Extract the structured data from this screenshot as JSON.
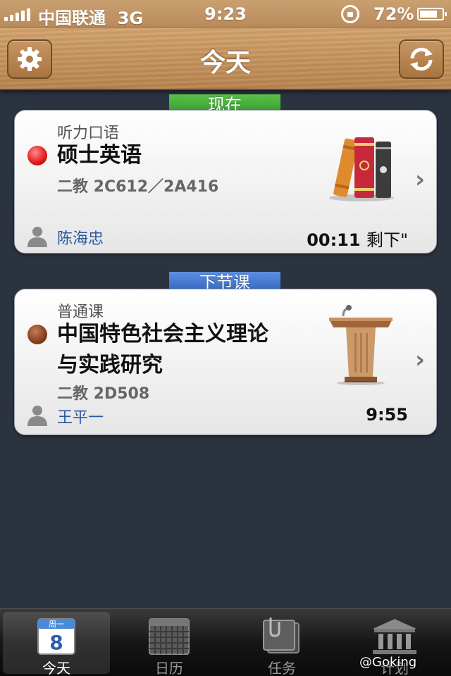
{
  "status_bar": {
    "carrier": "中国联通",
    "network": "3G",
    "time": "9:23",
    "battery": "72%"
  },
  "nav": {
    "title": "今天",
    "left_icon": "gear-icon",
    "right_icon": "refresh-icon"
  },
  "current": {
    "ribbon": "现在",
    "type": "听力口语",
    "name": "硕士英语",
    "room": "二教 2C612／2A416",
    "teacher": "陈海忠",
    "time_value": "00:11",
    "time_suffix": "剩下\"",
    "status_color": "#e01818",
    "illustration": "books-icon"
  },
  "next": {
    "ribbon": "下节课",
    "type": "普通课",
    "name_line1": "中国特色社会主义理论",
    "name_line2": "与实践研究",
    "room": "二教 2D508",
    "teacher": "王平一",
    "time": "9:55",
    "status_color": "#7f3a1b",
    "illustration": "lectern-icon"
  },
  "tabs": [
    {
      "label": "今天",
      "icon": "today-calendar-icon",
      "active": true,
      "cal_weekday": "周一",
      "cal_day": "8"
    },
    {
      "label": "日历",
      "icon": "calendar-grid-icon",
      "active": false
    },
    {
      "label": "任务",
      "icon": "tasks-icon",
      "active": false
    },
    {
      "label": "计划",
      "icon": "plan-building-icon",
      "active": false
    }
  ],
  "watermark": "@Goking"
}
